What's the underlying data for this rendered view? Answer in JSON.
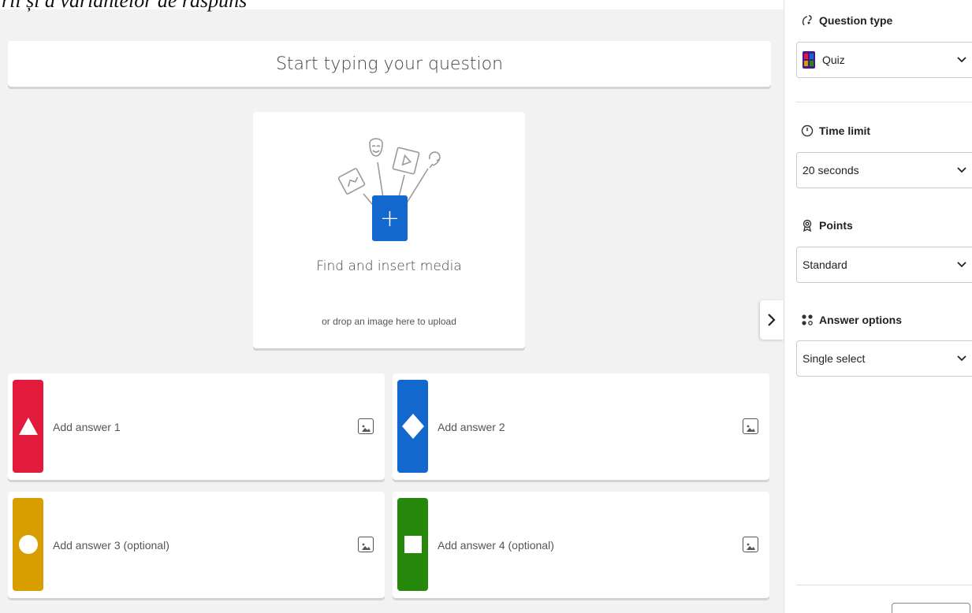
{
  "caption": "rii și a variantelor de răspuns",
  "question": {
    "placeholder": "Start typing your question"
  },
  "media": {
    "title": "Find and insert media",
    "subtitle": "or drop an image here to upload",
    "plus_label": "+"
  },
  "answers": [
    {
      "label": "Add answer 1",
      "color": "#e21b3c",
      "shape": "triangle-icon"
    },
    {
      "label": "Add answer 2",
      "color": "#1368ce",
      "shape": "diamond-icon"
    },
    {
      "label": "Add answer 3 (optional)",
      "color": "#d89e00",
      "shape": "circle-icon"
    },
    {
      "label": "Add answer 4 (optional)",
      "color": "#26890c",
      "shape": "square-icon"
    }
  ],
  "panel": {
    "question_type": {
      "label": "Question type",
      "value": "Quiz"
    },
    "time_limit": {
      "label": "Time limit",
      "value": "20 seconds"
    },
    "points": {
      "label": "Points",
      "value": "Standard"
    },
    "answer_options": {
      "label": "Answer options",
      "value": "Single select"
    }
  },
  "icons": [
    "question-type-icon",
    "quiz-icon",
    "clock-icon",
    "award-icon",
    "dots-grid-icon",
    "chevron-down-icon",
    "chevron-right-icon",
    "image-icon",
    "plus-icon"
  ]
}
